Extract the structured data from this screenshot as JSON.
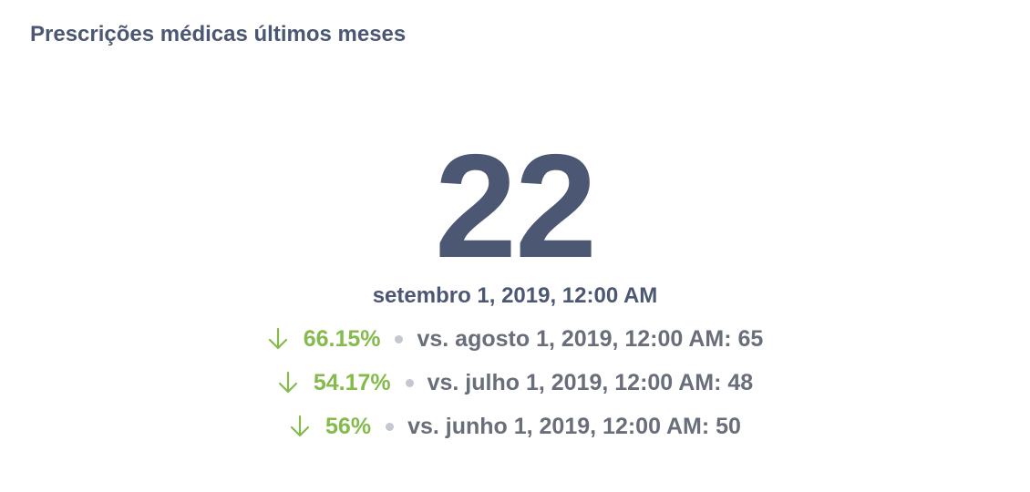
{
  "card": {
    "title": "Prescrições médicas últimos meses"
  },
  "scalar": {
    "value": "22",
    "period": "setembro 1, 2019, 12:00 AM"
  },
  "comparisons": [
    {
      "direction_icon": "arrow-down-icon",
      "change": "66.15%",
      "label": "vs. agosto 1, 2019, 12:00 AM: 65"
    },
    {
      "direction_icon": "arrow-down-icon",
      "change": "54.17%",
      "label": "vs. julho 1, 2019, 12:00 AM: 48"
    },
    {
      "direction_icon": "arrow-down-icon",
      "change": "56%",
      "label": "vs. junho 1, 2019, 12:00 AM: 50"
    }
  ],
  "colors": {
    "text": "#4c5773",
    "positive_change": "#84bb4c",
    "secondary_text": "#696e7b",
    "separator_dot": "#c4c7d0"
  }
}
